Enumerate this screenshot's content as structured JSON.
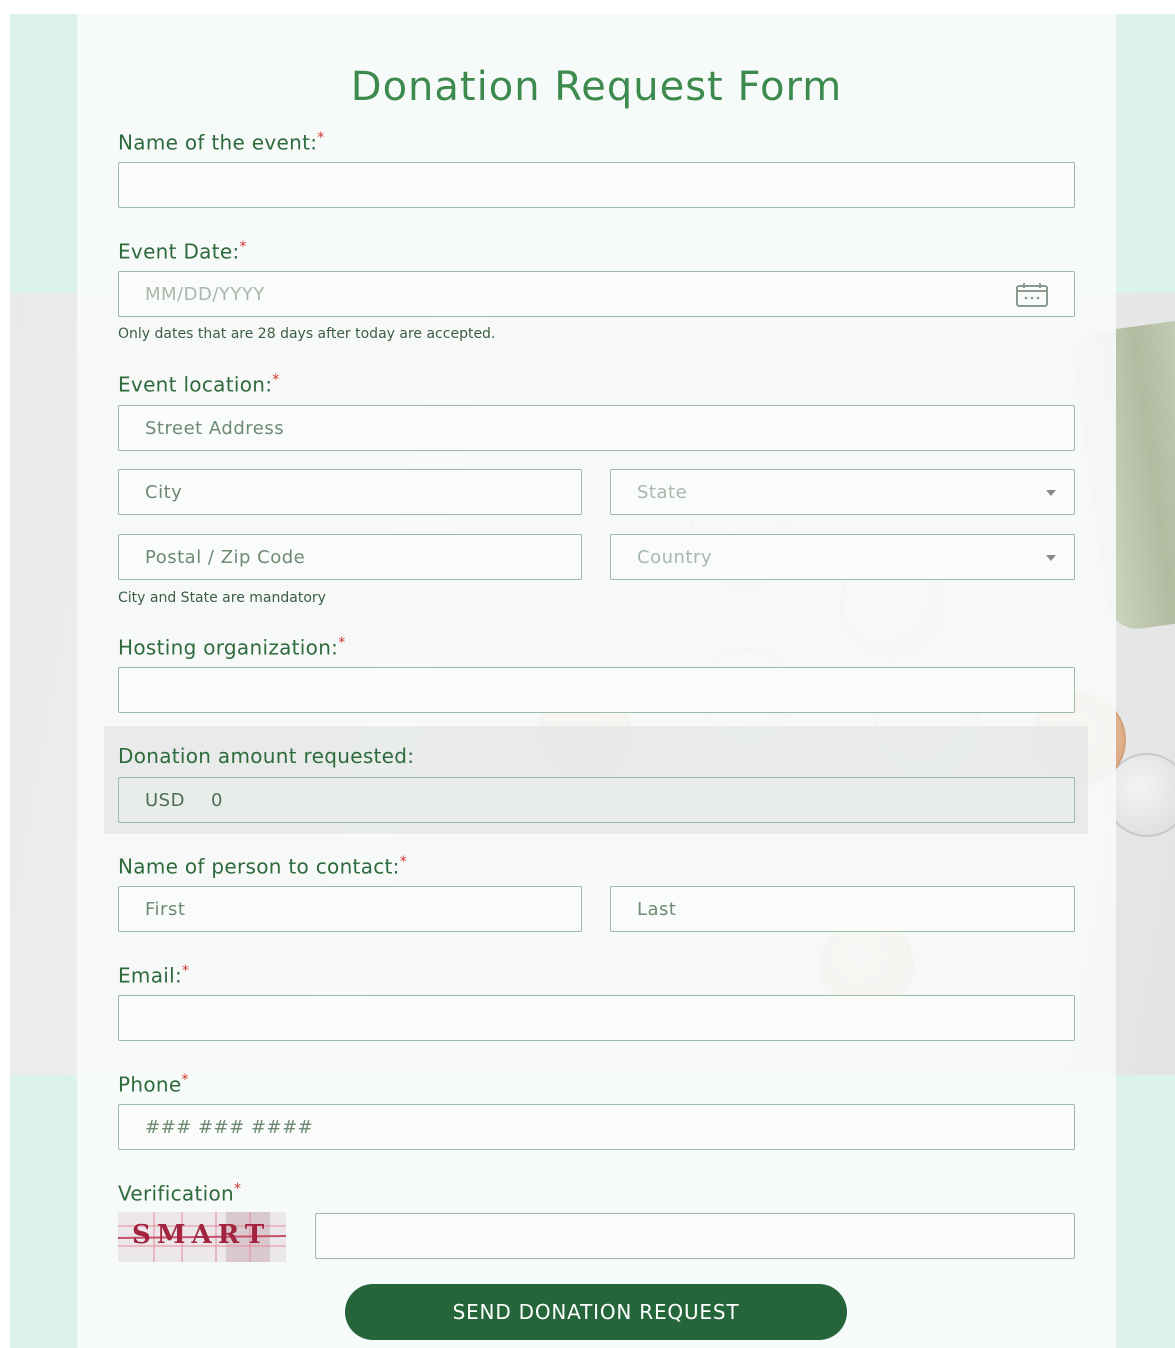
{
  "form": {
    "title": "Donation Request Form",
    "required_mark": "*",
    "event_name": {
      "label": "Name of the event:",
      "value": ""
    },
    "event_date": {
      "label": "Event Date:",
      "placeholder": "MM/DD/YYYY",
      "icon": "calendar-icon",
      "hint": "Only dates that are 28 days after today are accepted."
    },
    "event_location": {
      "label": "Event location:",
      "street_placeholder": "Street Address",
      "city_placeholder": "City",
      "state_placeholder": "State",
      "postal_placeholder": "Postal / Zip Code",
      "country_placeholder": "Country",
      "hint": "City and State are mandatory"
    },
    "hosting_org": {
      "label": "Hosting organization:",
      "value": ""
    },
    "donation": {
      "label": "Donation amount requested:",
      "currency": "USD",
      "value": "0"
    },
    "contact": {
      "label": "Name of person to contact:",
      "first_placeholder": "First",
      "last_placeholder": "Last"
    },
    "email": {
      "label": "Email:",
      "value": ""
    },
    "phone": {
      "label": "Phone",
      "placeholder": "### ### ####"
    },
    "verification": {
      "label": "Verification",
      "captcha_text": "SMART",
      "value": ""
    },
    "submit_label": "SEND DONATION REQUEST"
  },
  "colors": {
    "title": "#3c8a4e",
    "label": "#2f6a3c",
    "required": "#d0342c",
    "button": "#24663a",
    "page_background": "#dcf3ec"
  }
}
